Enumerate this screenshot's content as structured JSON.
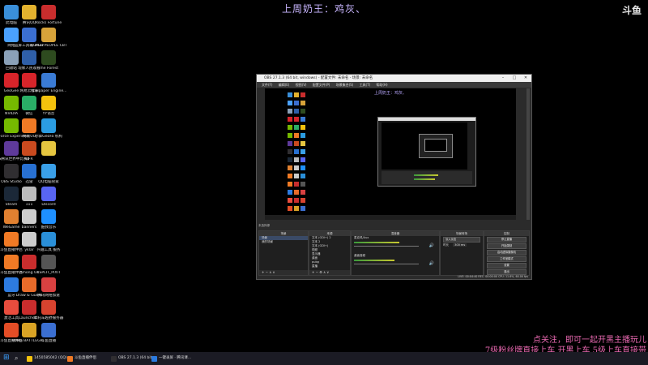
{
  "overlay": {
    "title": "上周奶王：鸡灰、",
    "logo": "斗鱼"
  },
  "desktop_icons": [
    {
      "label": "此电脑",
      "color": "#3a8fd9"
    },
    {
      "label": "腾讯QQ",
      "color": "#e3b22e"
    },
    {
      "label": "Rocks Fortune",
      "color": "#c92d2d"
    },
    {
      "label": "网络",
      "color": "#4aa1ff"
    },
    {
      "label": "蓝屏工具箱 2022",
      "color": "#3b6fd1"
    },
    {
      "label": "SUPER PEOPLE CBT",
      "color": "#d7a33a"
    },
    {
      "label": "回收站",
      "color": "#8aa0b8"
    },
    {
      "label": "现象人民观看",
      "color": "#2f5fa8"
    },
    {
      "label": "The Forest",
      "color": "#2e4b1f"
    },
    {
      "label": "GeoGee",
      "color": "#d7242a"
    },
    {
      "label": "网易云音乐",
      "color": "#d7242a"
    },
    {
      "label": "Wallpaper Engine...",
      "color": "#3a7bd5"
    },
    {
      "label": "NVIDIA",
      "color": "#76b900"
    },
    {
      "label": "微信",
      "color": "#2aae67"
    },
    {
      "label": "YY语音",
      "color": "#f4c20d"
    },
    {
      "label": "GeForce Experience",
      "color": "#76b900"
    },
    {
      "label": "网易UU",
      "color": "#f07a25"
    },
    {
      "label": "赤锋GeoFa 机构",
      "color": "#2b9de2"
    },
    {
      "label": "EGS腾讯世界中比赛集锦",
      "color": "#5f3a9a"
    },
    {
      "label": "GFR",
      "color": "#c94a1f"
    },
    {
      "label": "",
      "color": "#e6c640"
    },
    {
      "label": "OBS Studio",
      "color": "#302e31"
    },
    {
      "label": "迅雷",
      "color": "#2870d1"
    },
    {
      "label": "QQ电脑管家",
      "color": "#3aa0e8"
    },
    {
      "label": "Steam",
      "color": "#1b2838"
    },
    {
      "label": "111",
      "color": "#bbb"
    },
    {
      "label": "Discord",
      "color": "#5865f2"
    },
    {
      "label": "WeGame",
      "color": "#e08030"
    },
    {
      "label": "banners",
      "color": "#ccc"
    },
    {
      "label": "酷我音乐",
      "color": "#1e90ff"
    },
    {
      "label": "斗鱼直播伴侣",
      "color": "#f07a25"
    },
    {
      "label": "yklar",
      "color": "#ccc"
    },
    {
      "label": "兴趣工具 服务",
      "color": "#2a8fd8"
    },
    {
      "label": "斗鱼直播伴侣",
      "color": "#f07a25"
    },
    {
      "label": "Among Us",
      "color": "#c92d2d"
    },
    {
      "label": "XSPLIT_PIXIT",
      "color": "#555"
    },
    {
      "label": "蓝牙",
      "color": "#2d7be0"
    },
    {
      "label": "Draw & Guess",
      "color": "#e86b2a"
    },
    {
      "label": "腾讯网络加速",
      "color": "#d94141"
    },
    {
      "label": "激活工具",
      "color": "#e84c3d"
    },
    {
      "label": "Launcher...",
      "color": "#c92d2d"
    },
    {
      "label": "摩托车越野服务器",
      "color": "#d8432f"
    },
    {
      "label": "斗鱼直播伴侣",
      "color": "#e44d26"
    },
    {
      "label": "PUBG BATTLEGR...",
      "color": "#d9a325"
    },
    {
      "label": "斗鱼直播",
      "color": "#3b6fd1"
    }
  ],
  "obs": {
    "title": "OBS 27.1.3 (64 bit, windows) - 配置文件: 未命名 - 场景: 未命名",
    "menu": [
      "文件(F)",
      "编辑(E)",
      "视图(V)",
      "配置文件(P)",
      "场景集合(S)",
      "工具(T)",
      "帮助(H)"
    ],
    "inner_title": "上周奶王：鸡灰、",
    "docks": {
      "header": "未选择源",
      "scenes": {
        "title": "场景",
        "items": [
          "场景",
          "我的场景"
        ]
      },
      "sources": {
        "title": "来源",
        "items": [
          "文本 (GDI+) 2",
          "文本 2",
          "文本 (GDI+)",
          "视频",
          "显示器",
          "桌面",
          "pubg",
          "直播"
        ]
      },
      "mixer": {
        "title": "混音器",
        "tracks": [
          {
            "name": "麦克风/Aux",
            "level": 0.62
          },
          {
            "name": "桌面音频",
            "level": 0.55
          }
        ]
      },
      "transitions": {
        "title": "场景转场",
        "type": "淡入淡出",
        "duration_label": "时长",
        "duration": "300 ms"
      },
      "controls": {
        "title": "控制",
        "buttons": [
          "停止直播",
          "开始录制",
          "启动虚拟摄像机",
          "工作室模式",
          "设置",
          "退出"
        ]
      },
      "status": "LIVE: 00:04:40  REC: 00:00:00  CPU: 11.6%, 60.00 fps"
    }
  },
  "pink_texts": [
    "点关注，即可一起开黑主播玩儿",
    "7级粉丝牌直接上车 开黑上车 5级上车直接带"
  ],
  "taskbar": {
    "items": [
      {
        "label": "1450585042 (QQ)",
        "color": "#f4c20d"
      },
      {
        "label": "斗鱼直播伴侣",
        "color": "#f07a25"
      },
      {
        "label": "OBS 27.1.3 (64 bit,...",
        "color": "#302e31"
      },
      {
        "label": "一键录屏 · 腾讯课...",
        "color": "#2b7be0"
      }
    ]
  }
}
